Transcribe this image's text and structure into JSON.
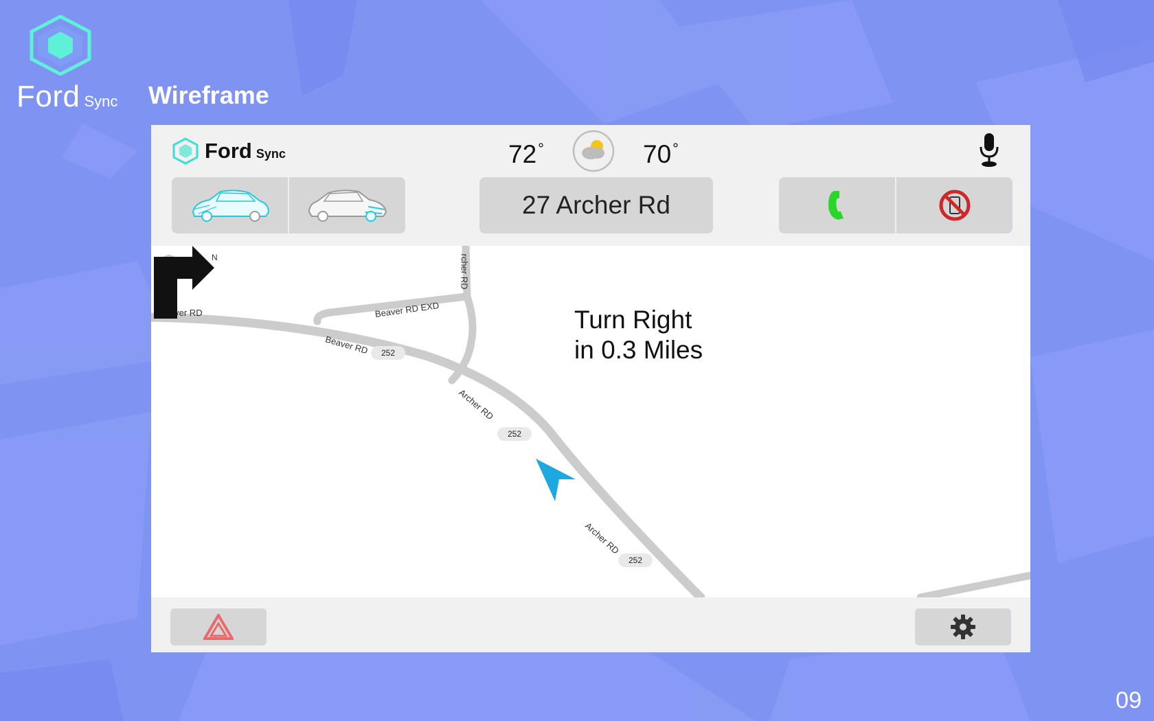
{
  "brand": {
    "name": "Ford",
    "sub": "Sync"
  },
  "page_heading": "Wireframe",
  "page_number": "09",
  "header": {
    "brand_name": "Ford",
    "brand_sub": "Sync",
    "temp_left": "72",
    "temp_right": "70",
    "degree_symbol": "°"
  },
  "address": "27 Archer Rd",
  "navigation": {
    "line1": "Turn Right",
    "line2": "in 0.3 Miles"
  },
  "map": {
    "compass_label": "N",
    "streets": {
      "beaver_rd_left": "Beaver RD",
      "beaver_rd_curve": "Beaver RD",
      "beaver_rd_exd": "Beaver RD EXD",
      "archer_rd_top": "rcher RD",
      "archer_rd_mid": "Archer RD",
      "archer_rd_low": "Archer RD"
    },
    "route_badges": [
      "252",
      "252",
      "252"
    ]
  },
  "icons": {
    "brand_logo": "hexagon-cube-logo-icon",
    "weather": "partly-cloudy-icon",
    "microphone": "microphone-icon",
    "car_front": "car-front-view-icon",
    "car_rear": "car-rear-view-icon",
    "phone": "phone-icon",
    "no_phone": "phone-disabled-icon",
    "compass": "compass-icon",
    "turn_right": "turn-right-arrow-icon",
    "position": "position-arrow-icon",
    "hazard": "hazard-icon",
    "settings": "gear-icon"
  },
  "colors": {
    "background": "#7f93f3",
    "accent_teal": "#3de0d0",
    "phone_green": "#2bd62b",
    "no_phone_red": "#cc2a2a",
    "hazard_red": "#e86a6a",
    "position_blue": "#1ea8e0"
  }
}
